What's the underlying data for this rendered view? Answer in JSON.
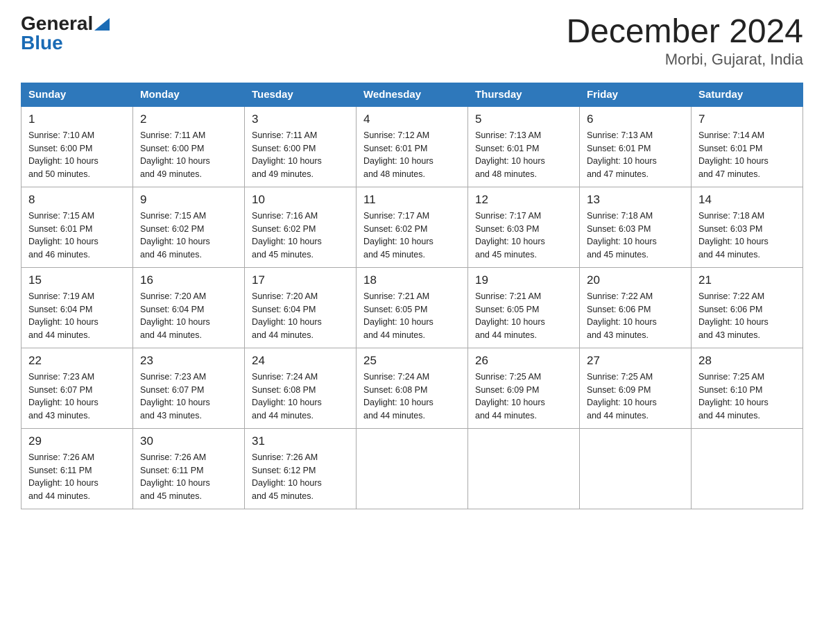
{
  "header": {
    "logo_line1": "General",
    "logo_line2": "Blue",
    "title": "December 2024",
    "subtitle": "Morbi, Gujarat, India"
  },
  "weekdays": [
    "Sunday",
    "Monday",
    "Tuesday",
    "Wednesday",
    "Thursday",
    "Friday",
    "Saturday"
  ],
  "weeks": [
    [
      {
        "day": "1",
        "sunrise": "7:10 AM",
        "sunset": "6:00 PM",
        "daylight": "10 hours and 50 minutes."
      },
      {
        "day": "2",
        "sunrise": "7:11 AM",
        "sunset": "6:00 PM",
        "daylight": "10 hours and 49 minutes."
      },
      {
        "day": "3",
        "sunrise": "7:11 AM",
        "sunset": "6:00 PM",
        "daylight": "10 hours and 49 minutes."
      },
      {
        "day": "4",
        "sunrise": "7:12 AM",
        "sunset": "6:01 PM",
        "daylight": "10 hours and 48 minutes."
      },
      {
        "day": "5",
        "sunrise": "7:13 AM",
        "sunset": "6:01 PM",
        "daylight": "10 hours and 48 minutes."
      },
      {
        "day": "6",
        "sunrise": "7:13 AM",
        "sunset": "6:01 PM",
        "daylight": "10 hours and 47 minutes."
      },
      {
        "day": "7",
        "sunrise": "7:14 AM",
        "sunset": "6:01 PM",
        "daylight": "10 hours and 47 minutes."
      }
    ],
    [
      {
        "day": "8",
        "sunrise": "7:15 AM",
        "sunset": "6:01 PM",
        "daylight": "10 hours and 46 minutes."
      },
      {
        "day": "9",
        "sunrise": "7:15 AM",
        "sunset": "6:02 PM",
        "daylight": "10 hours and 46 minutes."
      },
      {
        "day": "10",
        "sunrise": "7:16 AM",
        "sunset": "6:02 PM",
        "daylight": "10 hours and 45 minutes."
      },
      {
        "day": "11",
        "sunrise": "7:17 AM",
        "sunset": "6:02 PM",
        "daylight": "10 hours and 45 minutes."
      },
      {
        "day": "12",
        "sunrise": "7:17 AM",
        "sunset": "6:03 PM",
        "daylight": "10 hours and 45 minutes."
      },
      {
        "day": "13",
        "sunrise": "7:18 AM",
        "sunset": "6:03 PM",
        "daylight": "10 hours and 45 minutes."
      },
      {
        "day": "14",
        "sunrise": "7:18 AM",
        "sunset": "6:03 PM",
        "daylight": "10 hours and 44 minutes."
      }
    ],
    [
      {
        "day": "15",
        "sunrise": "7:19 AM",
        "sunset": "6:04 PM",
        "daylight": "10 hours and 44 minutes."
      },
      {
        "day": "16",
        "sunrise": "7:20 AM",
        "sunset": "6:04 PM",
        "daylight": "10 hours and 44 minutes."
      },
      {
        "day": "17",
        "sunrise": "7:20 AM",
        "sunset": "6:04 PM",
        "daylight": "10 hours and 44 minutes."
      },
      {
        "day": "18",
        "sunrise": "7:21 AM",
        "sunset": "6:05 PM",
        "daylight": "10 hours and 44 minutes."
      },
      {
        "day": "19",
        "sunrise": "7:21 AM",
        "sunset": "6:05 PM",
        "daylight": "10 hours and 44 minutes."
      },
      {
        "day": "20",
        "sunrise": "7:22 AM",
        "sunset": "6:06 PM",
        "daylight": "10 hours and 43 minutes."
      },
      {
        "day": "21",
        "sunrise": "7:22 AM",
        "sunset": "6:06 PM",
        "daylight": "10 hours and 43 minutes."
      }
    ],
    [
      {
        "day": "22",
        "sunrise": "7:23 AM",
        "sunset": "6:07 PM",
        "daylight": "10 hours and 43 minutes."
      },
      {
        "day": "23",
        "sunrise": "7:23 AM",
        "sunset": "6:07 PM",
        "daylight": "10 hours and 43 minutes."
      },
      {
        "day": "24",
        "sunrise": "7:24 AM",
        "sunset": "6:08 PM",
        "daylight": "10 hours and 44 minutes."
      },
      {
        "day": "25",
        "sunrise": "7:24 AM",
        "sunset": "6:08 PM",
        "daylight": "10 hours and 44 minutes."
      },
      {
        "day": "26",
        "sunrise": "7:25 AM",
        "sunset": "6:09 PM",
        "daylight": "10 hours and 44 minutes."
      },
      {
        "day": "27",
        "sunrise": "7:25 AM",
        "sunset": "6:09 PM",
        "daylight": "10 hours and 44 minutes."
      },
      {
        "day": "28",
        "sunrise": "7:25 AM",
        "sunset": "6:10 PM",
        "daylight": "10 hours and 44 minutes."
      }
    ],
    [
      {
        "day": "29",
        "sunrise": "7:26 AM",
        "sunset": "6:11 PM",
        "daylight": "10 hours and 44 minutes."
      },
      {
        "day": "30",
        "sunrise": "7:26 AM",
        "sunset": "6:11 PM",
        "daylight": "10 hours and 45 minutes."
      },
      {
        "day": "31",
        "sunrise": "7:26 AM",
        "sunset": "6:12 PM",
        "daylight": "10 hours and 45 minutes."
      },
      null,
      null,
      null,
      null
    ]
  ],
  "labels": {
    "sunrise": "Sunrise:",
    "sunset": "Sunset:",
    "daylight": "Daylight:"
  }
}
